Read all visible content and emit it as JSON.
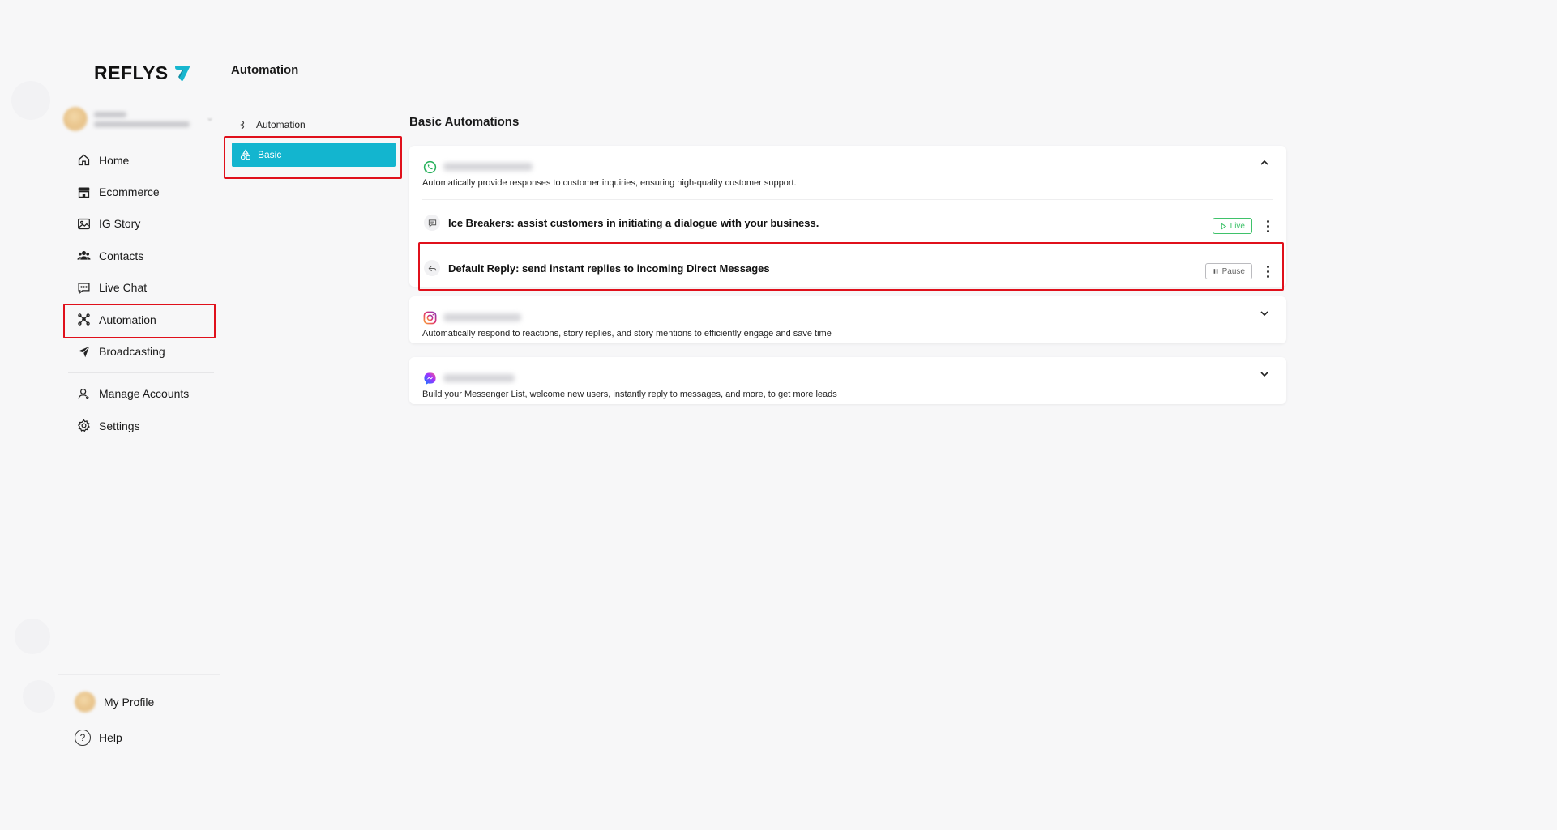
{
  "brand": {
    "name": "REFLYS",
    "accent": "#13b5cf",
    "highlight": "#e0101b"
  },
  "sidebar": {
    "items": [
      {
        "label": "Home",
        "icon": "home-icon"
      },
      {
        "label": "Ecommerce",
        "icon": "store-icon"
      },
      {
        "label": "IG Story",
        "icon": "image-icon"
      },
      {
        "label": "Contacts",
        "icon": "users-icon"
      },
      {
        "label": "Live Chat",
        "icon": "chat-icon"
      },
      {
        "label": "Automation",
        "icon": "automation-icon"
      },
      {
        "label": "Broadcasting",
        "icon": "send-icon"
      },
      {
        "label": "Manage Accounts",
        "icon": "user-icon"
      },
      {
        "label": "Settings",
        "icon": "gear-icon"
      }
    ],
    "bottom": {
      "profile": "My Profile",
      "help": "Help"
    }
  },
  "header": {
    "title": "Automation"
  },
  "submenu": {
    "parent": "Automation",
    "active": "Basic"
  },
  "main": {
    "section_title": "Basic Automations",
    "cards": [
      {
        "channel_icon": "whatsapp-icon",
        "description": "Automatically provide responses to customer inquiries, ensuring high-quality customer support.",
        "expanded": true,
        "rows": [
          {
            "label": "Ice Breakers: assist customers in initiating a dialogue with your business.",
            "status": "Live",
            "icon": "message-icon"
          },
          {
            "label": "Default Reply: send instant replies to incoming Direct Messages",
            "status": "Pause",
            "icon": "reply-icon"
          }
        ]
      },
      {
        "channel_icon": "instagram-icon",
        "description": "Automatically respond to reactions, story replies, and story mentions to efficiently engage and save time",
        "expanded": false
      },
      {
        "channel_icon": "messenger-icon",
        "description": "Build your Messenger List, welcome new users, instantly reply to messages, and more, to get more leads",
        "expanded": false
      }
    ]
  }
}
